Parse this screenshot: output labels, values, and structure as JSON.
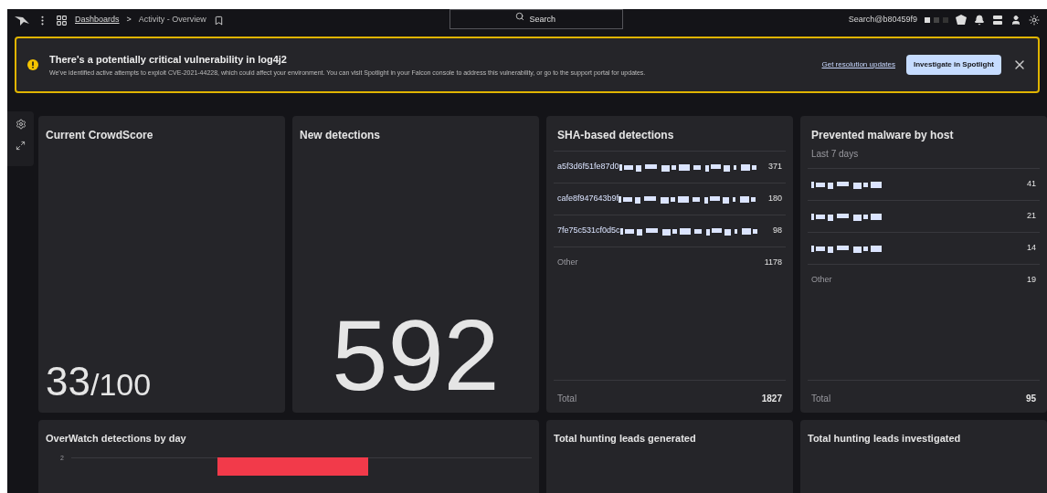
{
  "topbar": {
    "breadcrumb_separator": ">",
    "breadcrumb": [
      {
        "label": "Dashboards",
        "link": true
      },
      {
        "label": "Activity - Overview",
        "link": false
      }
    ],
    "search": {
      "placeholder": "Search"
    },
    "user": "Search@b80459f9"
  },
  "banner": {
    "title": "There's a potentially critical vulnerability in log4j2",
    "message": "We've identified active attempts to exploit CVE-2021-44228, which could affect your environment. You can visit Spotlight in your Falcon console to address this vulnerability, or go to the support portal for updates.",
    "link": "Get resolution updates",
    "button": "Investigate in Spotlight"
  },
  "cards": [
    {
      "kind": "score",
      "title": "Current CrowdScore",
      "value": "33",
      "suffix": "/100"
    },
    {
      "kind": "big",
      "title": "New detections",
      "value": "592"
    },
    {
      "kind": "list",
      "title": "SHA-based detections",
      "rows": [
        {
          "label": "a5f3d6f51fe87d0",
          "redacted": true,
          "value": "371"
        },
        {
          "label": "cafe8f947643b9f",
          "redacted": true,
          "value": "180"
        },
        {
          "label": "7fe75c531cf0d5c",
          "redacted": true,
          "value": "98"
        },
        {
          "label": "Other",
          "redacted": false,
          "value": "1178"
        }
      ],
      "total_label": "Total",
      "total": "1827"
    },
    {
      "kind": "list",
      "title": "Prevented malware by host",
      "subtitle": "Last 7 days",
      "rows": [
        {
          "redacted": true,
          "value": "41"
        },
        {
          "redacted": true,
          "value": "21"
        },
        {
          "redacted": true,
          "value": "14"
        },
        {
          "label": "Other",
          "redacted": false,
          "value": "19"
        }
      ],
      "total_label": "Total",
      "total": "95"
    }
  ],
  "bottom_cards": [
    {
      "kind": "chart",
      "title": "OverWatch detections by day",
      "y_tick_label": "2"
    },
    {
      "kind": "empty",
      "title": "Total hunting leads generated"
    },
    {
      "kind": "empty",
      "title": "Total hunting leads investigated"
    }
  ]
}
